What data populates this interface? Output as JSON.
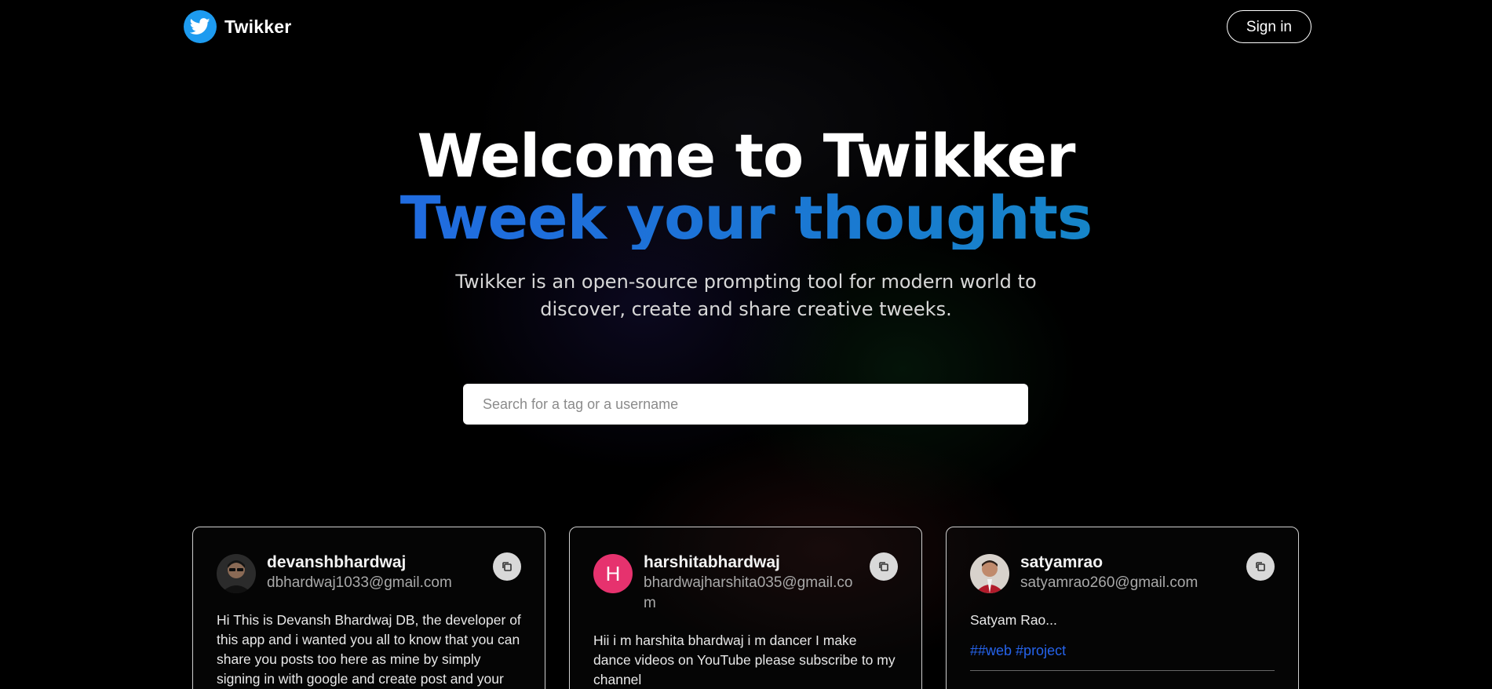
{
  "nav": {
    "brand": "Twikker",
    "signin_label": "Sign in"
  },
  "hero": {
    "title_line1": "Welcome to Twikker",
    "title_line2": "Tweek your thoughts",
    "tagline": "Twikker is an open-source prompting tool for modern world to discover, create and share creative tweeks."
  },
  "search": {
    "placeholder": "Search for a tag or a username",
    "value": ""
  },
  "posts": [
    {
      "username": "devanshbhardwaj",
      "email": "dbhardwaj1033@gmail.com",
      "avatar": "photo",
      "text": "Hi This is Devansh Bhardwaj DB, the developer of this app and i wanted you all to know that you can share you posts too here as mine by simply signing in with google and create post and your"
    },
    {
      "username": "harshitabhardwaj",
      "email": "bhardwajharshita035@gmail.com",
      "avatar_letter": "H",
      "text": "Hii i m harshita bhardwaj i m dancer I make dance videos on YouTube please subscribe to my channel"
    },
    {
      "username": "satyamrao",
      "email": "satyamrao260@gmail.com",
      "avatar": "photo",
      "text": "Satyam Rao...",
      "tags": "##web #project"
    }
  ],
  "colors": {
    "brand_blue": "#1d9bf0",
    "gradient_start": "#2563eb",
    "gradient_end": "#0e97b8",
    "tag_blue": "#2563eb",
    "avatar_pink": "#e6326e"
  },
  "icons": {
    "logo": "twitter-bird-icon",
    "copy": "copy-icon"
  }
}
